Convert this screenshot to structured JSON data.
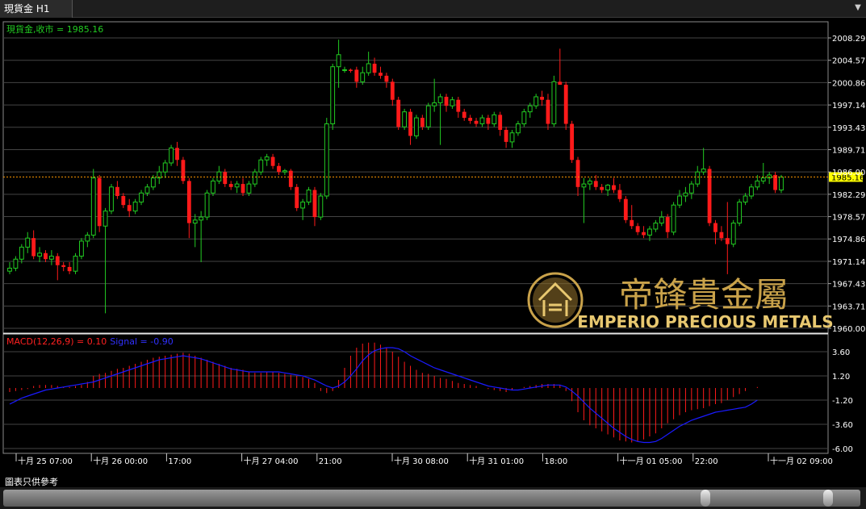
{
  "window": {
    "tab_title": "現貨金 H1",
    "menu_icon": "dropdown-arrow-icon"
  },
  "price_panel": {
    "legend": "現貨金,收市 = 1985.16",
    "current_price_label": "1985.16",
    "axis_labels": [
      "2008.29",
      "2004.57",
      "2000.86",
      "1997.14",
      "1993.43",
      "1989.71",
      "1986.00",
      "1982.29",
      "1978.57",
      "1974.86",
      "1971.14",
      "1967.43",
      "1963.71",
      "1960.00"
    ]
  },
  "macd_panel": {
    "legend_macd": "MACD(12,26,9) = 0.10",
    "legend_signal": "Signal = -0.90",
    "axis_labels": [
      "3.60",
      "1.20",
      "-1.20",
      "-3.60",
      "-6.00"
    ]
  },
  "time_axis": {
    "labels": [
      "十月 25 07:00",
      "十月 26 00:00",
      "17:00",
      "十月 27 04:00",
      "21:00",
      "十月 30 08:00",
      "十月 31 01:00",
      "18:00",
      "十一月 01 05:00",
      "22:00",
      "十一月 02 09:00"
    ]
  },
  "watermark": {
    "name_cn": "帝鋒貴金屬",
    "name_en": "EMPERIO PRECIOUS METALS"
  },
  "footer": {
    "disclaimer": "圖表只供參考"
  },
  "colors": {
    "up": "#22cc22",
    "down": "#ff1a1a",
    "signal": "#1a1aff",
    "grid": "#444444",
    "legend_price": "#22cc22",
    "legend_macd": "#ff2020",
    "current_price_line": "#ff9900",
    "gold": "#c9a24a"
  },
  "chart_data": {
    "type": "candlestick",
    "symbol": "現貨金",
    "timeframe": "H1",
    "ylim": [
      1960.0,
      2009.0
    ],
    "close_last": 1985.16,
    "candles": [
      {
        "o": 1969.5,
        "h": 1971.0,
        "l": 1969.0,
        "c": 1970.0
      },
      {
        "o": 1970.0,
        "h": 1972.0,
        "l": 1969.5,
        "c": 1971.5
      },
      {
        "o": 1971.5,
        "h": 1974.0,
        "l": 1970.8,
        "c": 1973.5
      },
      {
        "o": 1973.5,
        "h": 1976.0,
        "l": 1972.5,
        "c": 1975.0
      },
      {
        "o": 1975.0,
        "h": 1976.3,
        "l": 1971.5,
        "c": 1972.0
      },
      {
        "o": 1972.0,
        "h": 1973.5,
        "l": 1971.0,
        "c": 1972.5
      },
      {
        "o": 1972.5,
        "h": 1973.0,
        "l": 1971.0,
        "c": 1971.5
      },
      {
        "o": 1971.5,
        "h": 1973.0,
        "l": 1970.5,
        "c": 1972.0
      },
      {
        "o": 1972.0,
        "h": 1972.5,
        "l": 1968.0,
        "c": 1970.5
      },
      {
        "o": 1970.5,
        "h": 1971.0,
        "l": 1969.5,
        "c": 1970.2
      },
      {
        "o": 1970.2,
        "h": 1971.0,
        "l": 1969.0,
        "c": 1969.5
      },
      {
        "o": 1969.5,
        "h": 1972.5,
        "l": 1969.0,
        "c": 1972.0
      },
      {
        "o": 1972.0,
        "h": 1975.0,
        "l": 1971.5,
        "c": 1974.5
      },
      {
        "o": 1974.5,
        "h": 1976.0,
        "l": 1973.5,
        "c": 1975.5
      },
      {
        "o": 1975.5,
        "h": 1986.5,
        "l": 1975.0,
        "c": 1985.0
      },
      {
        "o": 1985.0,
        "h": 1985.5,
        "l": 1976.0,
        "c": 1977.0
      },
      {
        "o": 1977.0,
        "h": 1980.0,
        "l": 1962.5,
        "c": 1979.5
      },
      {
        "o": 1979.5,
        "h": 1984.0,
        "l": 1979.0,
        "c": 1983.5
      },
      {
        "o": 1983.5,
        "h": 1984.5,
        "l": 1981.5,
        "c": 1982.0
      },
      {
        "o": 1982.0,
        "h": 1982.5,
        "l": 1980.0,
        "c": 1980.5
      },
      {
        "o": 1980.5,
        "h": 1981.5,
        "l": 1978.5,
        "c": 1979.5
      },
      {
        "o": 1979.5,
        "h": 1981.5,
        "l": 1979.0,
        "c": 1981.0
      },
      {
        "o": 1981.0,
        "h": 1983.0,
        "l": 1980.5,
        "c": 1982.5
      },
      {
        "o": 1982.5,
        "h": 1984.0,
        "l": 1982.0,
        "c": 1983.5
      },
      {
        "o": 1983.5,
        "h": 1985.5,
        "l": 1983.0,
        "c": 1985.0
      },
      {
        "o": 1985.0,
        "h": 1987.0,
        "l": 1984.0,
        "c": 1986.0
      },
      {
        "o": 1986.0,
        "h": 1988.0,
        "l": 1985.0,
        "c": 1987.5
      },
      {
        "o": 1987.5,
        "h": 1990.5,
        "l": 1987.0,
        "c": 1990.0
      },
      {
        "o": 1990.0,
        "h": 1991.0,
        "l": 1987.0,
        "c": 1988.0
      },
      {
        "o": 1988.0,
        "h": 1988.5,
        "l": 1984.0,
        "c": 1984.5
      },
      {
        "o": 1984.5,
        "h": 1985.0,
        "l": 1975.0,
        "c": 1977.5
      },
      {
        "o": 1977.5,
        "h": 1979.0,
        "l": 1973.5,
        "c": 1978.0
      },
      {
        "o": 1978.0,
        "h": 1979.5,
        "l": 1971.0,
        "c": 1978.5
      },
      {
        "o": 1978.5,
        "h": 1983.0,
        "l": 1978.0,
        "c": 1982.5
      },
      {
        "o": 1982.5,
        "h": 1985.0,
        "l": 1982.0,
        "c": 1984.5
      },
      {
        "o": 1984.5,
        "h": 1987.0,
        "l": 1984.0,
        "c": 1986.0
      },
      {
        "o": 1986.0,
        "h": 1986.5,
        "l": 1983.5,
        "c": 1984.0
      },
      {
        "o": 1984.0,
        "h": 1984.5,
        "l": 1983.0,
        "c": 1983.5
      },
      {
        "o": 1983.5,
        "h": 1984.5,
        "l": 1982.5,
        "c": 1984.0
      },
      {
        "o": 1984.0,
        "h": 1985.0,
        "l": 1982.0,
        "c": 1982.5
      },
      {
        "o": 1982.5,
        "h": 1984.5,
        "l": 1982.0,
        "c": 1984.0
      },
      {
        "o": 1984.0,
        "h": 1986.5,
        "l": 1983.5,
        "c": 1986.0
      },
      {
        "o": 1986.0,
        "h": 1988.5,
        "l": 1985.5,
        "c": 1988.0
      },
      {
        "o": 1988.0,
        "h": 1989.0,
        "l": 1987.0,
        "c": 1988.5
      },
      {
        "o": 1988.5,
        "h": 1989.0,
        "l": 1986.5,
        "c": 1987.0
      },
      {
        "o": 1987.0,
        "h": 1987.5,
        "l": 1985.5,
        "c": 1986.0
      },
      {
        "o": 1986.0,
        "h": 1986.5,
        "l": 1985.5,
        "c": 1986.2
      },
      {
        "o": 1986.2,
        "h": 1986.5,
        "l": 1983.0,
        "c": 1983.5
      },
      {
        "o": 1983.5,
        "h": 1984.0,
        "l": 1979.5,
        "c": 1980.0
      },
      {
        "o": 1980.0,
        "h": 1981.5,
        "l": 1978.0,
        "c": 1981.0
      },
      {
        "o": 1981.0,
        "h": 1983.5,
        "l": 1980.5,
        "c": 1983.0
      },
      {
        "o": 1983.0,
        "h": 1983.5,
        "l": 1977.0,
        "c": 1978.5
      },
      {
        "o": 1978.5,
        "h": 1982.5,
        "l": 1978.0,
        "c": 1982.0
      },
      {
        "o": 1982.0,
        "h": 1995.0,
        "l": 1981.5,
        "c": 1994.0
      },
      {
        "o": 1994.0,
        "h": 2004.0,
        "l": 1993.0,
        "c": 2003.5
      },
      {
        "o": 2003.5,
        "h": 2008.0,
        "l": 2000.0,
        "c": 2005.5
      },
      {
        "o": 2003.0,
        "h": 2003.5,
        "l": 2002.5,
        "c": 2003.0
      },
      {
        "o": 2003.0,
        "h": 2003.2,
        "l": 2002.5,
        "c": 2002.8
      },
      {
        "o": 2003.0,
        "h": 2003.5,
        "l": 2000.0,
        "c": 2001.0
      },
      {
        "o": 2001.0,
        "h": 2003.5,
        "l": 2000.5,
        "c": 2002.5
      },
      {
        "o": 2002.5,
        "h": 2006.0,
        "l": 2002.0,
        "c": 2004.0
      },
      {
        "o": 2004.0,
        "h": 2005.0,
        "l": 2002.0,
        "c": 2002.5
      },
      {
        "o": 2002.5,
        "h": 2003.5,
        "l": 2001.5,
        "c": 2002.0
      },
      {
        "o": 2002.0,
        "h": 2002.5,
        "l": 2000.0,
        "c": 2001.0
      },
      {
        "o": 2001.0,
        "h": 2001.5,
        "l": 1997.0,
        "c": 1998.0
      },
      {
        "o": 1998.0,
        "h": 1998.5,
        "l": 1993.0,
        "c": 1993.5
      },
      {
        "o": 1993.5,
        "h": 1996.5,
        "l": 1993.0,
        "c": 1996.0
      },
      {
        "o": 1996.0,
        "h": 1996.5,
        "l": 1990.5,
        "c": 1992.0
      },
      {
        "o": 1992.0,
        "h": 1995.5,
        "l": 1991.5,
        "c": 1995.0
      },
      {
        "o": 1995.0,
        "h": 1995.5,
        "l": 1993.0,
        "c": 1993.5
      },
      {
        "o": 1993.5,
        "h": 1997.5,
        "l": 1993.0,
        "c": 1997.0
      },
      {
        "o": 1997.0,
        "h": 2001.5,
        "l": 1996.0,
        "c": 1997.5
      },
      {
        "o": 1997.5,
        "h": 1999.0,
        "l": 1990.5,
        "c": 1998.5
      },
      {
        "o": 1998.5,
        "h": 1999.0,
        "l": 1996.0,
        "c": 1997.0
      },
      {
        "o": 1997.0,
        "h": 1998.5,
        "l": 1996.5,
        "c": 1998.0
      },
      {
        "o": 1998.0,
        "h": 1998.5,
        "l": 1995.0,
        "c": 1996.0
      },
      {
        "o": 1996.0,
        "h": 1996.5,
        "l": 1994.5,
        "c": 1995.0
      },
      {
        "o": 1995.0,
        "h": 1995.5,
        "l": 1994.0,
        "c": 1994.5
      },
      {
        "o": 1994.5,
        "h": 1995.0,
        "l": 1993.5,
        "c": 1994.0
      },
      {
        "o": 1994.0,
        "h": 1995.5,
        "l": 1993.5,
        "c": 1995.0
      },
      {
        "o": 1995.0,
        "h": 1995.5,
        "l": 1993.0,
        "c": 1994.0
      },
      {
        "o": 1994.0,
        "h": 1996.0,
        "l": 1993.5,
        "c": 1995.5
      },
      {
        "o": 1995.5,
        "h": 1996.0,
        "l": 1992.0,
        "c": 1993.0
      },
      {
        "o": 1993.0,
        "h": 1993.5,
        "l": 1990.0,
        "c": 1991.0
      },
      {
        "o": 1991.0,
        "h": 1993.0,
        "l": 1990.0,
        "c": 1992.5
      },
      {
        "o": 1992.5,
        "h": 1994.5,
        "l": 1992.0,
        "c": 1994.0
      },
      {
        "o": 1994.0,
        "h": 1996.5,
        "l": 1993.5,
        "c": 1996.0
      },
      {
        "o": 1996.0,
        "h": 1997.5,
        "l": 1995.0,
        "c": 1997.0
      },
      {
        "o": 1997.0,
        "h": 1999.0,
        "l": 1996.5,
        "c": 1998.5
      },
      {
        "o": 1998.5,
        "h": 1999.5,
        "l": 1997.0,
        "c": 1998.0
      },
      {
        "o": 1998.0,
        "h": 1999.0,
        "l": 1993.0,
        "c": 1994.0
      },
      {
        "o": 1994.0,
        "h": 2002.0,
        "l": 1993.5,
        "c": 2001.0
      },
      {
        "o": 2001.0,
        "h": 2006.5,
        "l": 2000.5,
        "c": 2000.5
      },
      {
        "o": 2000.5,
        "h": 2001.0,
        "l": 1993.0,
        "c": 1994.0
      },
      {
        "o": 1994.0,
        "h": 1994.5,
        "l": 1987.5,
        "c": 1988.0
      },
      {
        "o": 1988.0,
        "h": 1988.5,
        "l": 1982.0,
        "c": 1983.5
      },
      {
        "o": 1983.5,
        "h": 1985.0,
        "l": 1977.5,
        "c": 1984.0
      },
      {
        "o": 1984.0,
        "h": 1985.0,
        "l": 1983.0,
        "c": 1984.5
      },
      {
        "o": 1984.5,
        "h": 1985.5,
        "l": 1983.0,
        "c": 1983.5
      },
      {
        "o": 1983.5,
        "h": 1984.0,
        "l": 1982.5,
        "c": 1983.0
      },
      {
        "o": 1983.0,
        "h": 1984.0,
        "l": 1982.0,
        "c": 1983.8
      },
      {
        "o": 1983.8,
        "h": 1985.0,
        "l": 1982.5,
        "c": 1983.0
      },
      {
        "o": 1983.0,
        "h": 1984.0,
        "l": 1981.0,
        "c": 1981.5
      },
      {
        "o": 1981.5,
        "h": 1982.0,
        "l": 1977.5,
        "c": 1978.0
      },
      {
        "o": 1978.0,
        "h": 1980.5,
        "l": 1976.5,
        "c": 1977.0
      },
      {
        "o": 1977.0,
        "h": 1977.5,
        "l": 1975.5,
        "c": 1976.0
      },
      {
        "o": 1976.0,
        "h": 1977.0,
        "l": 1975.0,
        "c": 1975.5
      },
      {
        "o": 1975.5,
        "h": 1977.0,
        "l": 1974.5,
        "c": 1976.5
      },
      {
        "o": 1976.5,
        "h": 1978.0,
        "l": 1976.0,
        "c": 1977.5
      },
      {
        "o": 1977.5,
        "h": 1979.5,
        "l": 1977.0,
        "c": 1978.5
      },
      {
        "o": 1978.5,
        "h": 1979.0,
        "l": 1975.0,
        "c": 1976.0
      },
      {
        "o": 1976.0,
        "h": 1981.0,
        "l": 1975.5,
        "c": 1980.5
      },
      {
        "o": 1980.5,
        "h": 1983.0,
        "l": 1980.0,
        "c": 1982.0
      },
      {
        "o": 1982.0,
        "h": 1983.5,
        "l": 1981.0,
        "c": 1982.5
      },
      {
        "o": 1982.5,
        "h": 1984.5,
        "l": 1981.5,
        "c": 1984.0
      },
      {
        "o": 1984.0,
        "h": 1987.0,
        "l": 1983.5,
        "c": 1986.0
      },
      {
        "o": 1986.0,
        "h": 1990.0,
        "l": 1985.5,
        "c": 1986.5
      },
      {
        "o": 1986.5,
        "h": 1987.0,
        "l": 1977.0,
        "c": 1977.5
      },
      {
        "o": 1977.5,
        "h": 1978.0,
        "l": 1974.0,
        "c": 1976.0
      },
      {
        "o": 1976.0,
        "h": 1977.0,
        "l": 1974.5,
        "c": 1975.0
      },
      {
        "o": 1975.0,
        "h": 1981.0,
        "l": 1969.0,
        "c": 1974.0
      },
      {
        "o": 1974.0,
        "h": 1978.0,
        "l": 1973.5,
        "c": 1977.5
      },
      {
        "o": 1977.5,
        "h": 1981.5,
        "l": 1977.0,
        "c": 1981.0
      },
      {
        "o": 1981.0,
        "h": 1982.5,
        "l": 1980.5,
        "c": 1982.0
      },
      {
        "o": 1982.0,
        "h": 1984.0,
        "l": 1981.5,
        "c": 1983.5
      },
      {
        "o": 1983.5,
        "h": 1985.5,
        "l": 1983.0,
        "c": 1984.5
      },
      {
        "o": 1984.5,
        "h": 1987.5,
        "l": 1984.0,
        "c": 1985.0
      },
      {
        "o": 1985.0,
        "h": 1986.0,
        "l": 1984.0,
        "c": 1985.5
      },
      {
        "o": 1985.5,
        "h": 1986.0,
        "l": 1982.5,
        "c": 1983.0
      },
      {
        "o": 1983.0,
        "h": 1985.5,
        "l": 1982.5,
        "c": 1985.16
      }
    ],
    "macd_ylim": [
      -6.5,
      4.8
    ],
    "macd": [
      -0.4,
      -0.3,
      -0.2,
      -0.1,
      0.2,
      0.3,
      0.3,
      0.3,
      0.2,
      0.1,
      0.1,
      0.2,
      0.3,
      0.6,
      1.2,
      1.4,
      1.5,
      1.7,
      1.9,
      2.0,
      2.2,
      2.4,
      2.6,
      2.8,
      3.0,
      3.1,
      3.2,
      3.3,
      3.4,
      3.5,
      3.4,
      3.2,
      3.0,
      2.8,
      2.6,
      2.4,
      2.2,
      2.0,
      1.9,
      1.8,
      1.6,
      1.5,
      1.5,
      1.6,
      1.6,
      1.5,
      1.4,
      1.3,
      1.2,
      1.1,
      0.9,
      0.5,
      -0.3,
      -0.5,
      -0.3,
      0.8,
      2.0,
      3.2,
      4.0,
      4.4,
      4.5,
      4.5,
      4.3,
      4.0,
      3.6,
      3.1,
      2.6,
      2.2,
      1.8,
      1.5,
      1.4,
      1.2,
      1.0,
      0.9,
      0.7,
      0.5,
      0.4,
      0.3,
      0.2,
      0.0,
      -0.1,
      -0.2,
      -0.3,
      -0.4,
      -0.2,
      0.0,
      0.1,
      0.2,
      0.3,
      0.4,
      0.4,
      0.4,
      0.3,
      -0.3,
      -1.3,
      -2.4,
      -3.2,
      -3.7,
      -4.0,
      -4.3,
      -4.6,
      -4.9,
      -5.2,
      -5.3,
      -5.4,
      -5.3,
      -5.1,
      -4.8,
      -4.5,
      -4.0,
      -3.5,
      -3.1,
      -2.7,
      -2.4,
      -2.2,
      -2.1,
      -2.0,
      -1.8,
      -1.6,
      -1.5,
      -1.2,
      -0.9,
      -0.6,
      -0.3,
      0.0,
      0.1
    ],
    "signal": [
      -1.6,
      -1.3,
      -1.0,
      -0.8,
      -0.6,
      -0.4,
      -0.2,
      -0.1,
      0.0,
      0.1,
      0.2,
      0.3,
      0.4,
      0.5,
      0.6,
      0.8,
      1.0,
      1.2,
      1.4,
      1.6,
      1.8,
      2.0,
      2.2,
      2.4,
      2.6,
      2.8,
      2.9,
      3.0,
      3.1,
      3.2,
      3.1,
      3.0,
      2.9,
      2.7,
      2.5,
      2.3,
      2.1,
      1.9,
      1.8,
      1.7,
      1.6,
      1.6,
      1.6,
      1.6,
      1.6,
      1.6,
      1.5,
      1.4,
      1.3,
      1.2,
      1.0,
      0.8,
      0.5,
      0.2,
      0.0,
      0.2,
      0.6,
      1.2,
      1.9,
      2.7,
      3.3,
      3.7,
      3.9,
      4.0,
      4.0,
      3.9,
      3.6,
      3.2,
      2.9,
      2.6,
      2.3,
      2.0,
      1.8,
      1.6,
      1.4,
      1.2,
      1.0,
      0.8,
      0.6,
      0.4,
      0.2,
      0.1,
      0.0,
      -0.1,
      -0.2,
      -0.2,
      -0.1,
      0.0,
      0.1,
      0.2,
      0.3,
      0.3,
      0.3,
      0.1,
      -0.3,
      -0.8,
      -1.4,
      -2.0,
      -2.5,
      -3.0,
      -3.5,
      -4.0,
      -4.4,
      -4.8,
      -5.1,
      -5.3,
      -5.4,
      -5.4,
      -5.3,
      -5.0,
      -4.6,
      -4.2,
      -3.8,
      -3.5,
      -3.2,
      -3.0,
      -2.8,
      -2.6,
      -2.4,
      -2.3,
      -2.2,
      -2.1,
      -2.0,
      -1.9,
      -1.6,
      -1.2
    ]
  }
}
